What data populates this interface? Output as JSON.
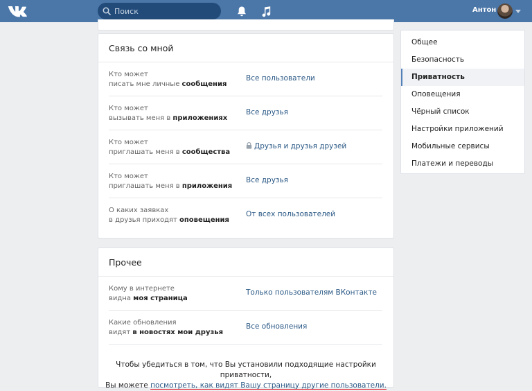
{
  "header": {
    "search_placeholder": "Поиск",
    "user_name": "Антон",
    "icons": [
      "vk-logo-icon",
      "search-icon",
      "bell-icon",
      "music-icon",
      "chevron-down-icon"
    ],
    "colors": {
      "topbar": "#4a76a8",
      "link": "#2a5885",
      "underline": "#e0202a"
    }
  },
  "contact": {
    "title": "Связь со мной",
    "rows": [
      {
        "label_line1": "Кто может",
        "label_line2_prefix": "писать мне личные ",
        "label_line2_bold": "сообщения",
        "value": "Все пользователи"
      },
      {
        "label_line1": "Кто может",
        "label_line2_prefix": "вызывать меня в ",
        "label_line2_bold": "приложениях",
        "value": "Все друзья"
      },
      {
        "label_line1": "Кто может",
        "label_line2_prefix": "приглашать меня в ",
        "label_line2_bold": "сообщества",
        "value": "Друзья и друзья друзей",
        "locked": true
      },
      {
        "label_line1": "Кто может",
        "label_line2_prefix": "приглашать меня в ",
        "label_line2_bold": "приложения",
        "value": "Все друзья"
      },
      {
        "label_line1": "О каких заявках",
        "label_line2_prefix": "в друзья приходят ",
        "label_line2_bold": "оповещения",
        "value": "От всех пользователей"
      }
    ]
  },
  "other": {
    "title": "Прочее",
    "rows": [
      {
        "label_line1": "Кому в интернете",
        "label_line2_prefix": "видна ",
        "label_line2_bold": "моя страница",
        "value": "Только пользователям ВКонтакте"
      },
      {
        "label_line1": "Какие обновления",
        "label_line2_prefix": "видят ",
        "label_line2_bold": "в новостях мои друзья",
        "value": "Все обновления"
      }
    ],
    "footer_line1": "Чтобы убедиться в том, что Вы установили подходящие настройки приватности,",
    "footer_line2_prefix": "Вы можете ",
    "footer_link": "посмотреть, как видят Вашу страницу другие пользователи."
  },
  "menu": {
    "items": [
      {
        "label": "Общее"
      },
      {
        "label": "Безопасность"
      },
      {
        "label": "Приватность",
        "active": true
      },
      {
        "label": "Оповещения"
      },
      {
        "label": "Чёрный список"
      },
      {
        "label": "Настройки приложений"
      },
      {
        "label": "Мобильные сервисы"
      },
      {
        "label": "Платежи и переводы"
      }
    ]
  }
}
